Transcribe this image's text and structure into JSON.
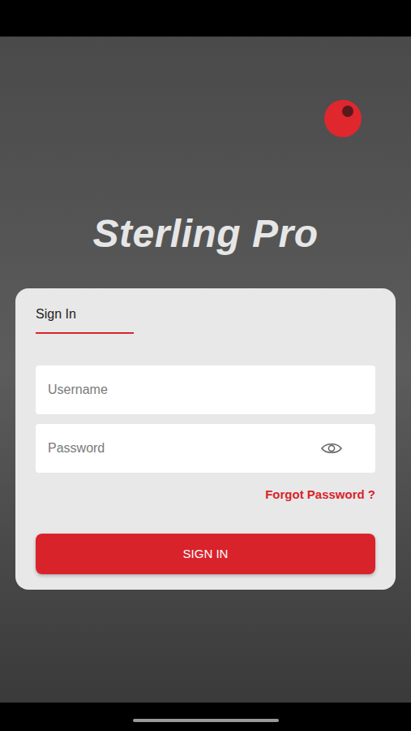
{
  "app": {
    "title": "Sterling Pro"
  },
  "tabs": [
    {
      "label": "Sign In",
      "selected": true
    }
  ],
  "form": {
    "username": {
      "placeholder": "Username"
    },
    "password": {
      "placeholder": "Password"
    },
    "forgot_link": "Forgot Password ?",
    "submit_button": "SIGN IN"
  }
}
